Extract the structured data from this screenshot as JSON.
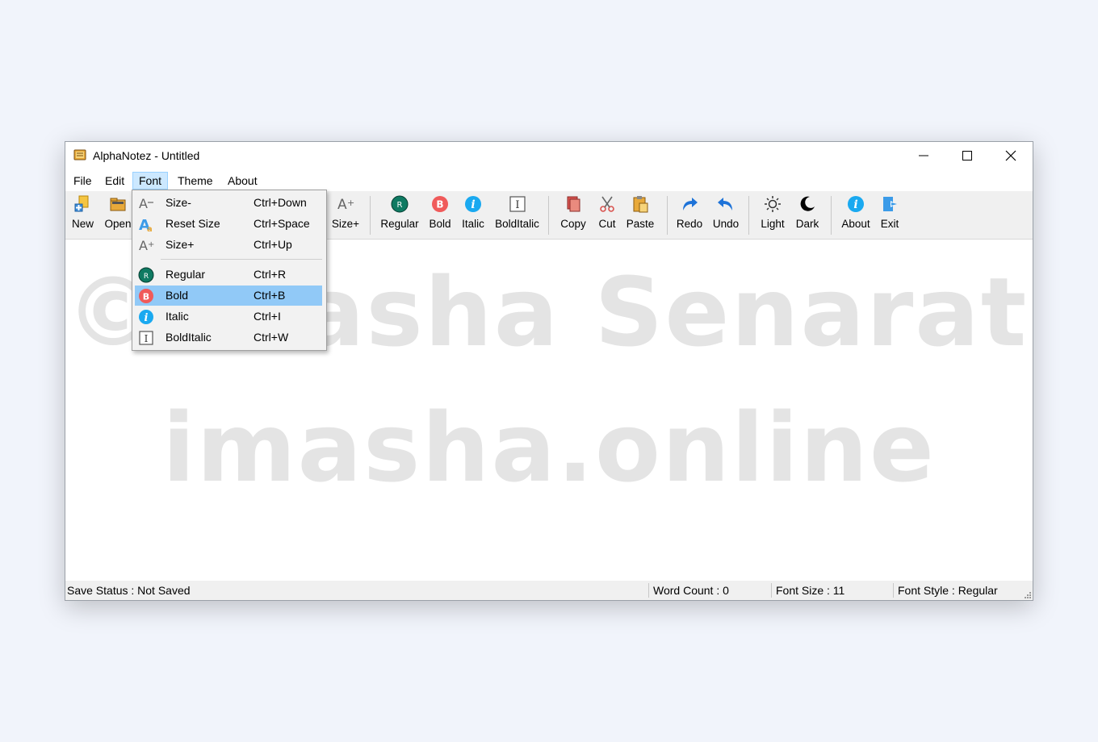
{
  "window": {
    "title": "AlphaNotez - Untitled"
  },
  "menu": {
    "file": "File",
    "edit": "Edit",
    "font": "Font",
    "theme": "Theme",
    "about": "About"
  },
  "toolbar": {
    "new": "New",
    "open": "Open",
    "size_plus": "Size+",
    "regular": "Regular",
    "bold": "Bold",
    "italic": "Italic",
    "bolditalic": "BoldItalic",
    "copy": "Copy",
    "cut": "Cut",
    "paste": "Paste",
    "redo": "Redo",
    "undo": "Undo",
    "light": "Light",
    "dark": "Dark",
    "about": "About",
    "exit": "Exit"
  },
  "font_menu": {
    "items": [
      {
        "label": "Size-",
        "shortcut": "Ctrl+Down"
      },
      {
        "label": "Reset Size",
        "shortcut": "Ctrl+Space"
      },
      {
        "label": "Size+",
        "shortcut": "Ctrl+Up"
      },
      {
        "label": "Regular",
        "shortcut": "Ctrl+R"
      },
      {
        "label": "Bold",
        "shortcut": "Ctrl+B"
      },
      {
        "label": "Italic",
        "shortcut": "Ctrl+I"
      },
      {
        "label": "BoldItalic",
        "shortcut": "Ctrl+W"
      }
    ]
  },
  "watermark": {
    "line1": "©Imasha Senarath",
    "line2": "imasha.online"
  },
  "status": {
    "save": "Save Status : Not Saved",
    "words": "Word Count : 0",
    "size": "Font Size : 11",
    "style": "Font Style : Regular"
  },
  "colors": {
    "menu_highlight": "#91c9f7",
    "active_menu": "#cce8ff",
    "regular": "#0f7a62",
    "bold": "#f05a5a",
    "italic": "#1aa9f0",
    "redo_undo": "#1e73d8"
  }
}
